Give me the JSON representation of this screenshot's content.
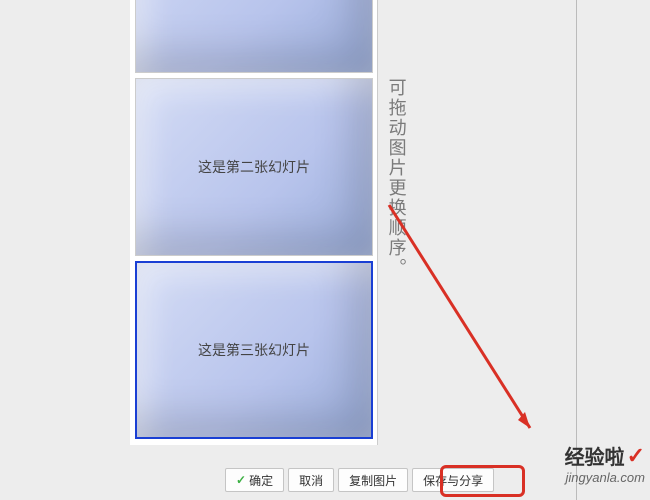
{
  "slides": [
    {
      "text": ""
    },
    {
      "text": "这是第二张幻灯片"
    },
    {
      "text": "这是第三张幻灯片"
    }
  ],
  "annotation": "可拖动图片更换顺序。",
  "buttons": {
    "confirm": "确定",
    "cancel": "取消",
    "copy": "复制图片",
    "save": "保存与分享"
  },
  "watermark": {
    "top": "经验啦",
    "bottom": "jingyanla.com"
  }
}
